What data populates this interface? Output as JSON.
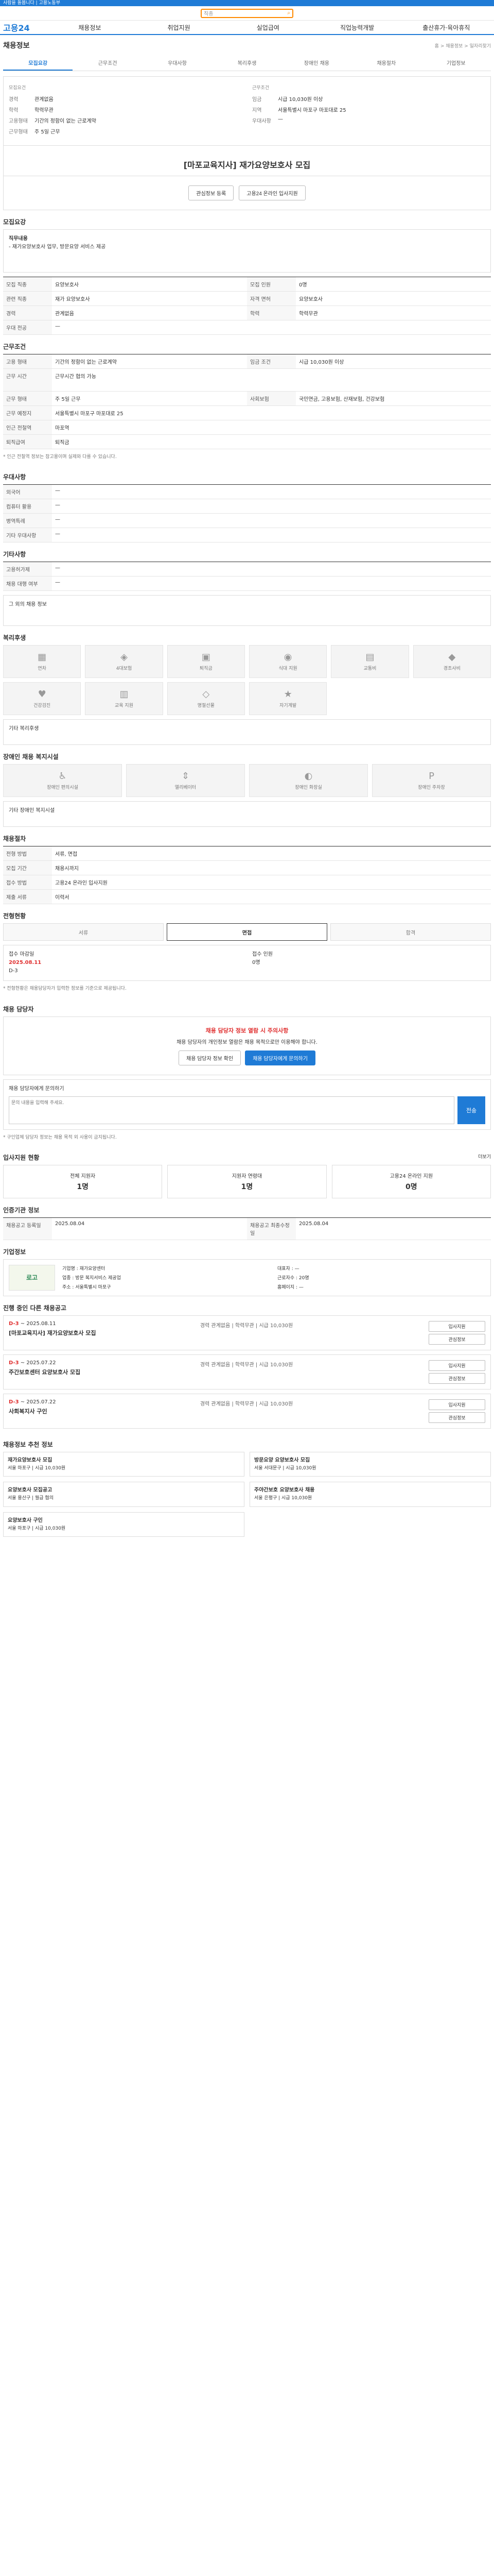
{
  "banner": {
    "text": "사람을 돌봅니다 | 고용노동부"
  },
  "search": {
    "placeholder": "직종"
  },
  "gnb": {
    "logo": "고용24",
    "items": [
      "채용정보",
      "취업지원",
      "실업급여",
      "직업능력개발",
      "출산휴가·육아휴직"
    ],
    "util": "로그인 | 회원가입"
  },
  "page": {
    "title": "채용정보",
    "breadcrumb": "홈 > 채용정보 > 일자리찾기"
  },
  "tabs": [
    "모집요강",
    "근무조건",
    "우대사항",
    "복리후생",
    "장애인 채용",
    "채용절차",
    "기업정보"
  ],
  "summary": {
    "left_label": "모집요건",
    "right_label": "근무조건",
    "left": [
      {
        "k": "경력",
        "v": "관계없음"
      },
      {
        "k": "학력",
        "v": "학력무관"
      },
      {
        "k": "고용형태",
        "v": "기간의 정함이 없는 근로계약"
      },
      {
        "k": "근무형태",
        "v": "주 5일 근무"
      }
    ],
    "right": [
      {
        "k": "임금",
        "v": "시급 10,030원 이상"
      },
      {
        "k": "지역",
        "v": "서울특별시 마포구 마포대로 25"
      },
      {
        "k": "우대사항",
        "v": "—"
      }
    ]
  },
  "job": {
    "title": "[마포교육지사] 재가요양보호사 모집",
    "scrap": "관심정보 등록",
    "apply": "고용24 온라인 입사지원"
  },
  "recruit": {
    "title": "모집요강",
    "duties_label": "직무내용",
    "duties": "- 재가요양보호사 업무, 방문요양 서비스 제공",
    "rows": [
      {
        "k": "모집 직종",
        "v": "요양보호사"
      },
      {
        "k": "모집 인원",
        "v": "0명"
      },
      {
        "k": "관련 직종",
        "v": "재가 요양보호사"
      },
      {
        "k": "자격 면허",
        "v": "요양보호사"
      },
      {
        "k": "경력",
        "v": "관계없음"
      },
      {
        "k": "학력",
        "v": "학력무관"
      },
      {
        "k": "우대 전공",
        "v": "—"
      }
    ]
  },
  "cond": {
    "title": "근무조건",
    "rows": [
      {
        "k": "고용 형태",
        "v": "기간의 정함이 없는 근로계약"
      },
      {
        "k": "임금 조건",
        "v": "시급 10,030원 이상"
      },
      {
        "k": "근무 시간",
        "v": "근무시간 협의 가능"
      },
      {
        "k": "근무 형태",
        "v": "주 5일 근무"
      },
      {
        "k": "사회보험",
        "v": "국민연금, 고용보험, 산재보험, 건강보험"
      },
      {
        "k": "근무 예정지",
        "v": "서울특별시 마포구 마포대로 25"
      },
      {
        "k": "인근 전철역",
        "v": "마포역"
      },
      {
        "k": "퇴직급여",
        "v": "퇴직금"
      }
    ],
    "note": "* 인근 전철역 정보는 참고용이며 실제와 다를 수 있습니다."
  },
  "pref": {
    "title": "우대사항",
    "rows": [
      {
        "k": "외국어",
        "v": "—"
      },
      {
        "k": "컴퓨터 활용",
        "v": "—"
      },
      {
        "k": "병역특례",
        "v": "—"
      },
      {
        "k": "기타 우대사항",
        "v": "—"
      }
    ]
  },
  "other": {
    "title": "기타사항",
    "rows": [
      {
        "k": "고용허가제",
        "v": "—"
      },
      {
        "k": "채용 대행 여부",
        "v": "—"
      }
    ],
    "box": "그 외의 채용 정보"
  },
  "welfare": {
    "title": "복리후생",
    "tiles": [
      "연차",
      "4대보험",
      "퇴직금",
      "식대 지원",
      "교통비",
      "경조사비",
      "건강검진",
      "교육 지원",
      "명절선물",
      "자기계발"
    ],
    "extra": "기타 복리후생"
  },
  "disable": {
    "title": "장애인 채용 복지시설",
    "tiles": [
      "장애인 편의시설",
      "엘리베이터",
      "장애인 화장실",
      "장애인 주차장"
    ],
    "extra": "기타 장애인 복지시설"
  },
  "proc": {
    "title": "채용절차",
    "rows": [
      {
        "k": "전형 방법",
        "v": "서류, 면접"
      },
      {
        "k": "모집 기간",
        "v": "채용시까지"
      },
      {
        "k": "접수 방법",
        "v": "고용24 온라인 입사지원"
      },
      {
        "k": "제출 서류",
        "v": "이력서"
      }
    ]
  },
  "status": {
    "title": "전형현황",
    "steps": [
      "서류",
      "면접",
      "합격"
    ],
    "received": "접수 마감일",
    "received_val": "2025.08.11",
    "left_d": "D-3",
    "right_label": "접수 인원",
    "right_val": "0명",
    "note": "* 전형현황은 채용담당자가 입력한 정보를 기준으로 제공됩니다."
  },
  "contact": {
    "title": "채용 담당자",
    "warn": "채용 담당자 정보 열람 시 주의사항",
    "desc": "채용 담당자의 개인정보 열람은 채용 목적으로만 이용해야 합니다.",
    "btn1": "채용 담당자 정보 확인",
    "btn2": "채용 담당자에게 문의하기",
    "qhead": "채용 담당자에게 문의하기",
    "qplaceholder": "문의 내용을 입력해 주세요.",
    "qbtn": "전송",
    "note": "* 구인업체 담당자 정보는 채용 목적 외 사용이 금지됩니다."
  },
  "stat": {
    "title": "입사지원 현황",
    "more": "더보기",
    "items": [
      {
        "k": "전체 지원자",
        "v": "1명"
      },
      {
        "k": "지원자 연령대",
        "v": "1명"
      },
      {
        "k": "고용24 온라인 지원",
        "v": "0명"
      }
    ]
  },
  "detail": {
    "title": "인증기관 정보",
    "rows": [
      {
        "k": "채용공고 등록일",
        "v": "2025.08.04"
      },
      {
        "k": "채용공고 최종수정일",
        "v": "2025.08.04"
      }
    ]
  },
  "company": {
    "title": "기업정보",
    "logo": "로고",
    "info": [
      {
        "k": "기업명",
        "v": "재가요양센터"
      },
      {
        "k": "대표자",
        "v": "—"
      },
      {
        "k": "업종",
        "v": "방문 복지서비스 제공업"
      },
      {
        "k": "근로자수",
        "v": "20명"
      },
      {
        "k": "주소",
        "v": "서울특별시 마포구"
      },
      {
        "k": "홈페이지",
        "v": "—"
      }
    ]
  },
  "related": {
    "title": "진행 중인 다른 채용공고",
    "cards": [
      {
        "dd": "D-3",
        "date": "~ 2025.08.11",
        "title": "[마포교육지사] 재가요양보호사 모집",
        "meta": "경력 관계없음 | 학력무관 | 시급 10,030원"
      },
      {
        "dd": "D-3",
        "date": "~ 2025.07.22",
        "title": "주간보호센터 요양보호사 모집",
        "meta": "경력 관계없음 | 학력무관 | 시급 10,030원"
      },
      {
        "dd": "D-3",
        "date": "~ 2025.07.22",
        "title": "사회복지사 구인",
        "meta": "경력 관계없음 | 학력무관 | 시급 10,030원"
      }
    ],
    "btn_a": "입사지원",
    "btn_b": "관심정보"
  },
  "recommend": {
    "title": "채용정보 추천 정보",
    "cards": [
      {
        "t": "재가요양보호사 모집",
        "s": "서울 마포구 | 시급 10,030원"
      },
      {
        "t": "방문요양 요양보호사 모집",
        "s": "서울 서대문구 | 시급 10,030원"
      },
      {
        "t": "요양보호사 모집공고",
        "s": "서울 용산구 | 월급 협의"
      },
      {
        "t": "주야간보호 요양보호사 채용",
        "s": "서울 은평구 | 시급 10,030원"
      },
      {
        "t": "요양보호사 구인",
        "s": "서울 마포구 | 시급 10,030원"
      }
    ]
  }
}
